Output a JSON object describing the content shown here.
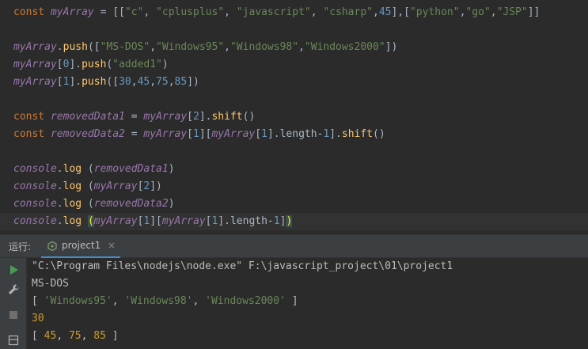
{
  "editor": {
    "lines": [
      {
        "tokens": [
          [
            "kw",
            "const "
          ],
          [
            "var",
            "myArray"
          ],
          [
            "ptxt",
            " = [["
          ],
          [
            "str",
            "\"c\""
          ],
          [
            "ptxt",
            ", "
          ],
          [
            "str",
            "\"cplusplus\""
          ],
          [
            "ptxt",
            ", "
          ],
          [
            "str",
            "\"javascript\""
          ],
          [
            "ptxt",
            ", "
          ],
          [
            "str",
            "\"csharp\""
          ],
          [
            "ptxt",
            ","
          ],
          [
            "num",
            "45"
          ],
          [
            "ptxt",
            "],["
          ],
          [
            "str",
            "\"python\""
          ],
          [
            "ptxt",
            ","
          ],
          [
            "str",
            "\"go\""
          ],
          [
            "ptxt",
            ","
          ],
          [
            "str",
            "\"JSP\""
          ],
          [
            "ptxt",
            "]]"
          ]
        ]
      },
      {
        "tokens": [
          [
            "var",
            "myArray"
          ],
          [
            "ptxt",
            "."
          ],
          [
            "fn",
            "push"
          ],
          [
            "ptxt",
            "(["
          ],
          [
            "str",
            "\"MS-DOS\""
          ],
          [
            "ptxt",
            ","
          ],
          [
            "str",
            "\"Windows95\""
          ],
          [
            "ptxt",
            ","
          ],
          [
            "str",
            "\"Windows98\""
          ],
          [
            "ptxt",
            ","
          ],
          [
            "str",
            "\"Windows2000\""
          ],
          [
            "ptxt",
            "])"
          ]
        ]
      },
      {
        "tokens": [
          [
            "var",
            "myArray"
          ],
          [
            "ptxt",
            "["
          ],
          [
            "num",
            "0"
          ],
          [
            "ptxt",
            "]."
          ],
          [
            "fn",
            "push"
          ],
          [
            "ptxt",
            "("
          ],
          [
            "str",
            "\"added1\""
          ],
          [
            "ptxt",
            ")"
          ]
        ]
      },
      {
        "tokens": [
          [
            "var",
            "myArray"
          ],
          [
            "ptxt",
            "["
          ],
          [
            "num",
            "1"
          ],
          [
            "ptxt",
            "]."
          ],
          [
            "fn",
            "push"
          ],
          [
            "ptxt",
            "(["
          ],
          [
            "num",
            "30"
          ],
          [
            "ptxt",
            ","
          ],
          [
            "num",
            "45"
          ],
          [
            "ptxt",
            ","
          ],
          [
            "num",
            "75"
          ],
          [
            "ptxt",
            ","
          ],
          [
            "num",
            "85"
          ],
          [
            "ptxt",
            "])"
          ]
        ]
      },
      {
        "tokens": [
          [
            "kw",
            "const "
          ],
          [
            "var",
            "removedData1"
          ],
          [
            "ptxt",
            " = "
          ],
          [
            "var",
            "myArray"
          ],
          [
            "ptxt",
            "["
          ],
          [
            "num",
            "2"
          ],
          [
            "ptxt",
            "]."
          ],
          [
            "fn",
            "shift"
          ],
          [
            "ptxt",
            "()"
          ]
        ]
      },
      {
        "tokens": [
          [
            "kw",
            "const "
          ],
          [
            "var",
            "removedData2"
          ],
          [
            "ptxt",
            " = "
          ],
          [
            "var",
            "myArray"
          ],
          [
            "ptxt",
            "["
          ],
          [
            "num",
            "1"
          ],
          [
            "ptxt",
            "]["
          ],
          [
            "var",
            "myArray"
          ],
          [
            "ptxt",
            "["
          ],
          [
            "num",
            "1"
          ],
          [
            "ptxt",
            "].length-"
          ],
          [
            "num",
            "1"
          ],
          [
            "ptxt",
            "]."
          ],
          [
            "fn",
            "shift"
          ],
          [
            "ptxt",
            "()"
          ]
        ]
      },
      {
        "tokens": [
          [
            "var",
            "console"
          ],
          [
            "ptxt",
            "."
          ],
          [
            "fn",
            "log"
          ],
          [
            "ptxt",
            " ("
          ],
          [
            "var",
            "removedData1"
          ],
          [
            "ptxt",
            ")"
          ]
        ]
      },
      {
        "tokens": [
          [
            "var",
            "console"
          ],
          [
            "ptxt",
            "."
          ],
          [
            "fn",
            "log"
          ],
          [
            "ptxt",
            " ("
          ],
          [
            "var",
            "myArray"
          ],
          [
            "ptxt",
            "["
          ],
          [
            "num",
            "2"
          ],
          [
            "ptxt",
            "])"
          ]
        ]
      },
      {
        "tokens": [
          [
            "var",
            "console"
          ],
          [
            "ptxt",
            "."
          ],
          [
            "fn",
            "log"
          ],
          [
            "ptxt",
            " ("
          ],
          [
            "var",
            "removedData2"
          ],
          [
            "ptxt",
            ")"
          ]
        ]
      },
      {
        "tokens": [
          [
            "var",
            "console"
          ],
          [
            "ptxt",
            "."
          ],
          [
            "fn",
            "log"
          ],
          [
            "ptxt",
            " "
          ],
          [
            "bracket-hl",
            "("
          ],
          [
            "var",
            "myArray"
          ],
          [
            "ptxt",
            "["
          ],
          [
            "num",
            "1"
          ],
          [
            "ptxt",
            "]["
          ],
          [
            "var",
            "myArray"
          ],
          [
            "ptxt",
            "["
          ],
          [
            "num",
            "1"
          ],
          [
            "ptxt",
            "].length-"
          ],
          [
            "num",
            "1"
          ],
          [
            "ptxt",
            "]"
          ],
          [
            "bracket-hl",
            ")"
          ]
        ]
      }
    ]
  },
  "run_panel": {
    "label": "运行:",
    "tab_label": "project1",
    "tab_close": "×"
  },
  "console": {
    "lines": [
      {
        "tokens": [
          [
            "plain",
            "\"C:\\Program Files\\nodejs\\node.exe\" F:\\javascript_project\\01\\project1"
          ]
        ]
      },
      {
        "tokens": [
          [
            "plain",
            "MS-DOS"
          ]
        ]
      },
      {
        "tokens": [
          [
            "plain",
            "[ "
          ],
          [
            "c-str",
            "'Windows95'"
          ],
          [
            "plain",
            ", "
          ],
          [
            "c-str",
            "'Windows98'"
          ],
          [
            "plain",
            ", "
          ],
          [
            "c-str",
            "'Windows2000'"
          ],
          [
            "plain",
            " ]"
          ]
        ]
      },
      {
        "tokens": [
          [
            "c-num",
            "30"
          ]
        ]
      },
      {
        "tokens": [
          [
            "plain",
            "[ "
          ],
          [
            "c-num",
            "45"
          ],
          [
            "plain",
            ", "
          ],
          [
            "c-num",
            "75"
          ],
          [
            "plain",
            ", "
          ],
          [
            "c-num",
            "85"
          ],
          [
            "plain",
            " ]"
          ]
        ]
      }
    ]
  },
  "icons": [
    "run-icon",
    "wrench-icon",
    "stop-icon",
    "layout-icon"
  ],
  "colors": {
    "accent_tab": "#4a88c7",
    "run_green": "#499c54"
  }
}
